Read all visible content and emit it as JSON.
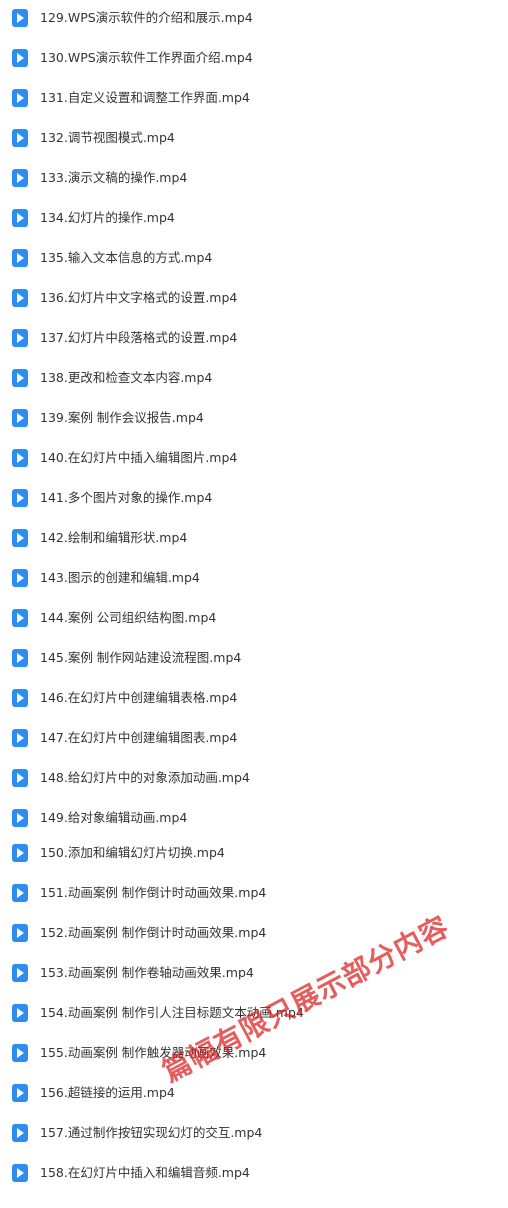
{
  "files": [
    "129.WPS演示软件的介绍和展示.mp4",
    "130.WPS演示软件工作界面介绍.mp4",
    "131.自定义设置和调整工作界面.mp4",
    "132.调节视图模式.mp4",
    "133.演示文稿的操作.mp4",
    "134.幻灯片的操作.mp4",
    "135.输入文本信息的方式.mp4",
    "136.幻灯片中文字格式的设置.mp4",
    "137.幻灯片中段落格式的设置.mp4",
    "138.更改和检查文本内容.mp4",
    "139.案例 制作会议报告.mp4",
    "140.在幻灯片中插入编辑图片.mp4",
    "141.多个图片对象的操作.mp4",
    "142.绘制和编辑形状.mp4",
    "143.图示的创建和编辑.mp4",
    "144.案例 公司组织结构图.mp4",
    "145.案例 制作网站建设流程图.mp4",
    "146.在幻灯片中创建编辑表格.mp4",
    "147.在幻灯片中创建编辑图表.mp4",
    "148.给幻灯片中的对象添加动画.mp4",
    "149.给对象编辑动画.mp4",
    "150.添加和编辑幻灯片切换.mp4",
    "151.动画案例 制作倒计时动画效果.mp4",
    "152.动画案例 制作倒计时动画效果.mp4",
    "153.动画案例 制作卷轴动画效果.mp4",
    "154.动画案例 制作引人注目标题文本动画.mp4",
    "155.动画案例 制作触发器动画效果.mp4",
    "156.超链接的运用.mp4",
    "157.通过制作按钮实现幻灯的交互.mp4",
    "158.在幻灯片中插入和编辑音频.mp4"
  ],
  "icon": "video-file-icon",
  "watermark": "篇幅有限只展示部分内容"
}
